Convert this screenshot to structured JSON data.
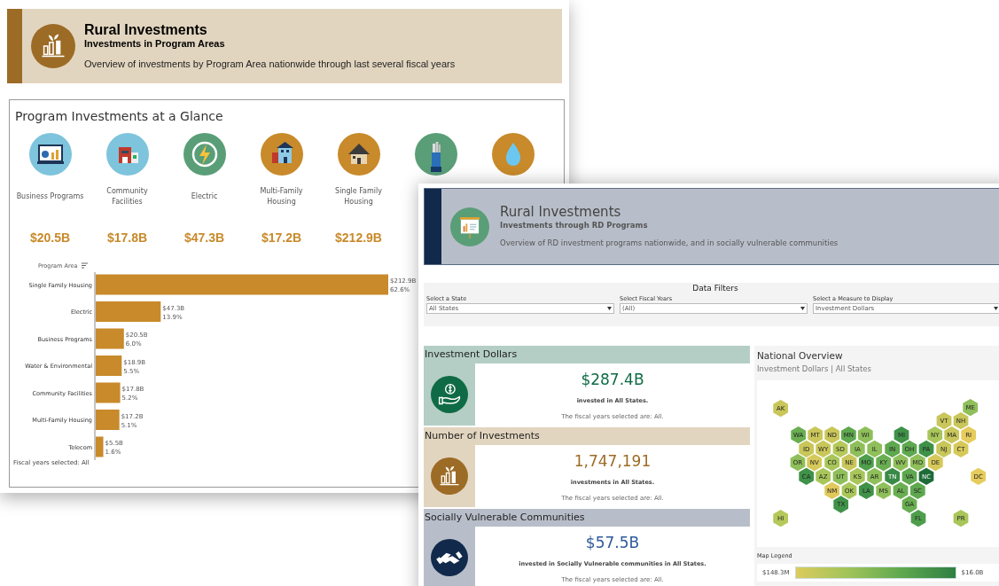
{
  "program_areas": {
    "header": {
      "title": "Rural Investments",
      "subtitle": "Investments in Program Areas",
      "description": "Overview of investments by Program Area nationwide through last several fiscal years"
    },
    "panel_title": "Program Investments at a Glance",
    "programs": [
      {
        "label": "Business Programs",
        "amount": "$20.5B",
        "color": "#7ec4dc"
      },
      {
        "label": "Community Facilities",
        "amount": "$17.8B",
        "color": "#7ec4dc"
      },
      {
        "label": "Electric",
        "amount": "$47.3B",
        "color": "#5a9e78"
      },
      {
        "label": "Multi-Family Housing",
        "amount": "$17.2B",
        "color": "#c88a2a"
      },
      {
        "label": "Single Family Housing",
        "amount": "$212.9B",
        "color": "#c88a2a"
      },
      {
        "color": "#5a9e78"
      },
      {
        "color": "#c88a2a"
      }
    ],
    "chart_data": {
      "type": "bar",
      "orientation": "horizontal",
      "ylabel": "Program Area",
      "categories": [
        "Single Family Housing",
        "Electric",
        "Business Programs",
        "Water & Environmental",
        "Community Facilities",
        "Multi-Family Housing",
        "Telecom"
      ],
      "series": [
        {
          "color": "#c88a2a",
          "values": [
            212.9,
            47.3,
            20.5,
            18.9,
            17.8,
            17.2,
            5.5
          ],
          "value_labels": [
            "$212.9B",
            "$47.3B",
            "$20.5B",
            "$18.9B",
            "$17.8B",
            "$17.2B",
            "$5.5B"
          ]
        }
      ],
      "annotations": [
        "62.6%",
        "13.9%",
        "6.0%",
        "5.5%",
        "5.2%",
        "5.1%",
        "1.6%"
      ]
    },
    "footer": "Fiscal years selected: All"
  },
  "rd_programs": {
    "header": {
      "title": "Rural Investments",
      "subtitle": "Investments through RD Programs",
      "description": "Overview of RD investment programs nationwide, and in socially vulnerable communities"
    },
    "filters": {
      "title": "Data Filters",
      "dropdowns": [
        {
          "label": "Select a State",
          "value": "All States"
        },
        {
          "label": "Select Fiscal Years",
          "value": "(All)"
        },
        {
          "label": "Select a Measure to Display",
          "value": "Investment Dollars"
        }
      ]
    },
    "cards": [
      {
        "kind": "dollars",
        "title": "Investment Dollars",
        "value": "$287.4B",
        "description": "invested in All States.",
        "note": "The fiscal years selected are: All."
      },
      {
        "kind": "count",
        "title": "Number of Investments",
        "value": "1,747,191",
        "description": "investments in All States.",
        "note": "The fiscal years selected are: All."
      },
      {
        "kind": "vulnerable",
        "title": "Socially Vulnerable Communities",
        "value": "$57.5B",
        "description": "invested in Socially Vulnerable communities in All States.",
        "note": "The fiscal years selected are: All."
      }
    ],
    "overview": {
      "title": "National Overview",
      "subtitle": "Investment Dollars | All States",
      "states": [
        {
          "label": "AK",
          "color": "#c9c65a"
        },
        {
          "label": "ME",
          "color": "#8fbf5a"
        },
        {
          "label": "VT",
          "color": "#c9c65a"
        },
        {
          "label": "NH",
          "color": "#c9c65a"
        },
        {
          "label": "WA",
          "color": "#6aae52"
        },
        {
          "label": "MT",
          "color": "#c9c65a"
        },
        {
          "label": "ND",
          "color": "#c9c65a"
        },
        {
          "label": "MN",
          "color": "#5ea84f"
        },
        {
          "label": "WI",
          "color": "#8fbf5a"
        },
        {
          "label": "MI",
          "color": "#3f9248"
        },
        {
          "label": "NY",
          "color": "#a8c65a"
        },
        {
          "label": "MA",
          "color": "#c9c65a"
        },
        {
          "label": "RI",
          "color": "#e6cc5c"
        },
        {
          "label": "ID",
          "color": "#c9c65a"
        },
        {
          "label": "WY",
          "color": "#c9c65a"
        },
        {
          "label": "SD",
          "color": "#b5c95a"
        },
        {
          "label": "IA",
          "color": "#8fbf5a"
        },
        {
          "label": "IL",
          "color": "#8fbf5a"
        },
        {
          "label": "IN",
          "color": "#5ea84f"
        },
        {
          "label": "OH",
          "color": "#5ea84f"
        },
        {
          "label": "PA",
          "color": "#3f9248"
        },
        {
          "label": "NJ",
          "color": "#c9c65a"
        },
        {
          "label": "CT",
          "color": "#d6c95a"
        },
        {
          "label": "OR",
          "color": "#8fbf5a"
        },
        {
          "label": "NV",
          "color": "#d6c95a"
        },
        {
          "label": "CO",
          "color": "#a8c65a"
        },
        {
          "label": "NE",
          "color": "#c9c65a"
        },
        {
          "label": "MO",
          "color": "#4e9e4b"
        },
        {
          "label": "KY",
          "color": "#6aae52"
        },
        {
          "label": "WV",
          "color": "#8fbf5a"
        },
        {
          "label": "MD",
          "color": "#8fbf5a"
        },
        {
          "label": "DE",
          "color": "#d6c95a"
        },
        {
          "label": "CA",
          "color": "#3f9248"
        },
        {
          "label": "AZ",
          "color": "#a8c65a"
        },
        {
          "label": "UT",
          "color": "#8fbf5a"
        },
        {
          "label": "KS",
          "color": "#a8c65a"
        },
        {
          "label": "AR",
          "color": "#8fbf5a"
        },
        {
          "label": "TN",
          "color": "#3a8a47"
        },
        {
          "label": "VA",
          "color": "#5ea84f"
        },
        {
          "label": "NC",
          "color": "#1e6b3a"
        },
        {
          "label": "DC",
          "color": "#e6cc5c"
        },
        {
          "label": "NM",
          "color": "#e0c95a"
        },
        {
          "label": "OK",
          "color": "#a8c65a"
        },
        {
          "label": "LA",
          "color": "#3f9248"
        },
        {
          "label": "MS",
          "color": "#8fbf5a"
        },
        {
          "label": "AL",
          "color": "#6aae52"
        },
        {
          "label": "SC",
          "color": "#5ea84f"
        },
        {
          "label": "TX",
          "color": "#3f9248"
        },
        {
          "label": "GA",
          "color": "#6aae52"
        },
        {
          "label": "HI",
          "color": "#b5c95a"
        },
        {
          "label": "FL",
          "color": "#4e9e4b"
        },
        {
          "label": "PR",
          "color": "#a8c65a"
        }
      ],
      "legend": {
        "title": "Map Legend",
        "min": "$148.3M",
        "max": "$16.0B"
      }
    }
  }
}
